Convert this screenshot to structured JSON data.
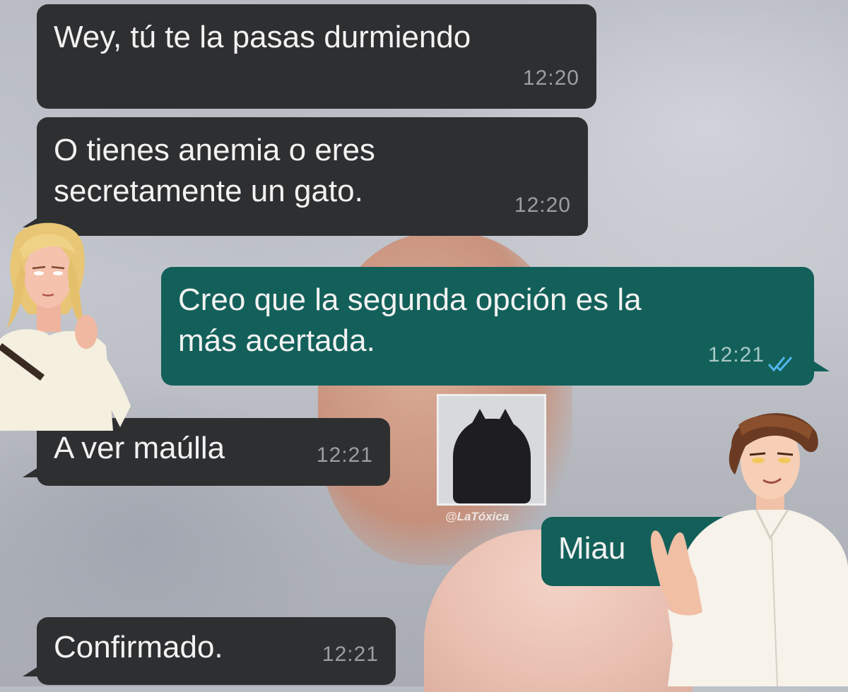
{
  "messages": [
    {
      "direction": "incoming",
      "text": "Wey, tú te la pasas durmiendo",
      "time": "12:20"
    },
    {
      "direction": "incoming",
      "text": "O tienes anemia o eres\nsecretamente un gato.",
      "time": "12:20"
    },
    {
      "direction": "outgoing",
      "text": "Creo que la segunda opción es la\nmás acertada.",
      "time": "12:21",
      "status": "double-check-icon"
    },
    {
      "direction": "incoming",
      "text": "A ver maúlla",
      "time": "12:21"
    },
    {
      "direction": "outgoing",
      "text": "Miau",
      "time": ""
    },
    {
      "direction": "incoming",
      "text": "Confirmado.",
      "time": "12:21"
    }
  ],
  "watermark": "@LaTóxica",
  "colors": {
    "incoming_bubble": "#2e2f31",
    "outgoing_bubble": "#13605a",
    "bubble_text": "#f2f2f2",
    "read_receipt": "#4fb6ec"
  }
}
